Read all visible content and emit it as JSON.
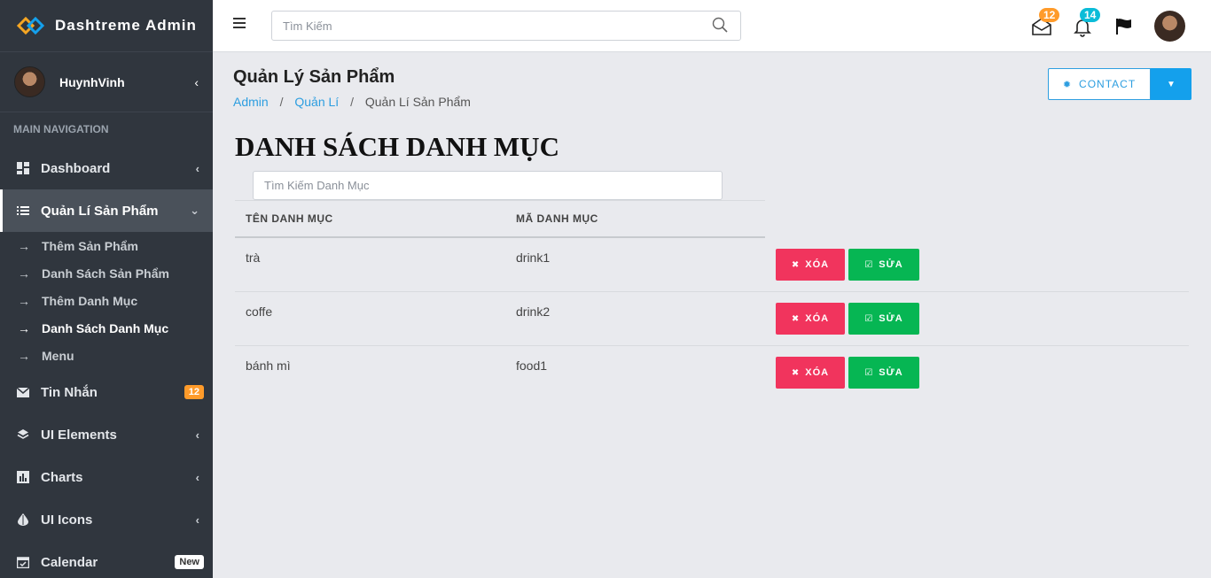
{
  "brand": {
    "title": "Dashtreme Admin"
  },
  "user": {
    "name": "HuynhVinh"
  },
  "nav": {
    "header": "MAIN NAVIGATION",
    "dashboard": "Dashboard",
    "products": "Quản Lí Sản Phẩm",
    "sub": [
      "Thêm Sản Phẩm",
      "Danh Sách Sản Phẩm",
      "Thêm Danh Mục",
      "Danh Sách Danh Mục",
      "Menu"
    ],
    "messages": "Tin Nhắn",
    "messages_badge": "12",
    "ui_elements": "UI Elements",
    "charts": "Charts",
    "ui_icons": "UI Icons",
    "calendar": "Calendar",
    "calendar_badge": "New"
  },
  "topbar": {
    "search_placeholder": "Tìm Kiếm",
    "mail_count": "12",
    "bell_count": "14"
  },
  "page": {
    "title": "Quản Lý Sản Phẩm",
    "breadcrumb": [
      "Admin",
      "Quản Lí",
      "Quản Lí Sản Phẩm"
    ],
    "contact_label": "CONTACT"
  },
  "list": {
    "title": "DANH SÁCH DANH MỤC",
    "search_placeholder": "Tìm Kiếm Danh Mục",
    "columns": [
      "TÊN DANH MỤC",
      "MÃ DANH MỤC"
    ],
    "rows": [
      {
        "name": "trà",
        "code": "drink1"
      },
      {
        "name": "coffe",
        "code": "drink2"
      },
      {
        "name": "bánh mì",
        "code": "food1"
      }
    ],
    "delete_label": "XÓA",
    "edit_label": "SỬA"
  },
  "colors": {
    "sidebar": "#30363e",
    "accent": "#2d9ee0",
    "danger": "#f1345d",
    "success": "#06b653",
    "badge_orange": "#ff9b2a",
    "badge_cyan": "#0bbcd8"
  }
}
